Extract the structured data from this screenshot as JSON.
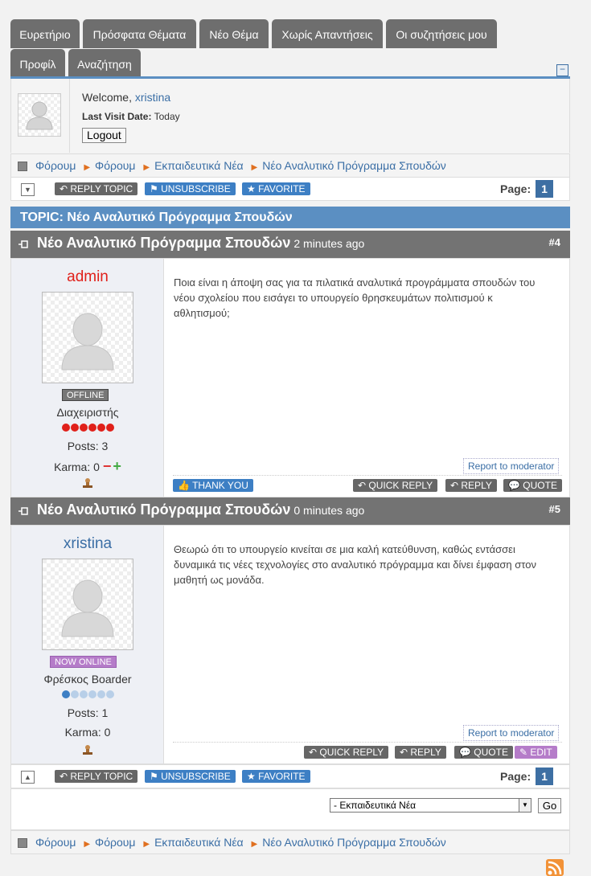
{
  "nav": {
    "tabs": [
      "Ευρετήριο",
      "Πρόσφατα Θέματα",
      "Νέο Θέμα",
      "Χωρίς Απαντήσεις",
      "Οι συζητήσεις μου",
      "Προφίλ",
      "Αναζήτηση"
    ]
  },
  "profile": {
    "welcome_prefix": "Welcome,",
    "username": "xristina",
    "last_visit_label": "Last Visit Date:",
    "last_visit_value": "Today",
    "logout_label": "Logout",
    "collapse_symbol": "−"
  },
  "breadcrumb": [
    "Φόρουμ",
    "Φόρουμ",
    "Εκπαιδευτικά Νέα",
    "Νέο Αναλυτικό Πρόγραμμα Σπουδών"
  ],
  "actions": {
    "reply_topic": "REPLY TOPIC",
    "unsubscribe": "UNSUBSCRIBE",
    "favorite": "FAVORITE",
    "page_label": "Page:",
    "page_number": "1"
  },
  "topic": {
    "title": "TOPIC: Νέο Αναλυτικό Πρόγραμμα Σπουδών"
  },
  "posts": [
    {
      "title": "Νέο Αναλυτικό Πρόγραμμα Σπουδών",
      "ago": "2 minutes ago",
      "number": "#4",
      "author": "admin",
      "author_color": "#e0201a",
      "status": "OFFLINE",
      "status_color": "#777777",
      "rank": "Διαχειριστής",
      "posts_label": "Posts: 3",
      "karma_label": "Karma: 0",
      "karma_minus": "−",
      "karma_plus": "+",
      "message": "Ποια είναι η άποψη σας για τα πιλατικά αναλυτικά προγράμματα σπουδών του νέου σχολείου που εισάγει το υπουργείο θρησκευμάτων πολιτισμού κ αθλητισμού;",
      "report_label": "Report to moderator",
      "thank_you": "THANK YOU",
      "quick_reply": "QUICK REPLY",
      "reply": "REPLY",
      "quote": "QUOTE"
    },
    {
      "title": "Νέο Αναλυτικό Πρόγραμμα Σπουδών",
      "ago": "0 minutes ago",
      "number": "#5",
      "author": "xristina",
      "author_color": "#3a6ea5",
      "status": "NOW ONLINE",
      "status_color": "#b57cc9",
      "rank": "Φρέσκος Boarder",
      "posts_label": "Posts: 1",
      "karma_label": "Karma: 0",
      "message": "Θεωρώ ότι το υπουργείο κινείται σε μια καλή κατεύθυνση, καθώς εντάσσει δυναμικά τις νέες τεχνολογίες στο αναλυτικό πρόγραμμα και δίνει έμφαση στον μαθητή ως μονάδα.",
      "report_label": "Report to moderator",
      "quick_reply": "QUICK REPLY",
      "reply": "REPLY",
      "quote": "QUOTE",
      "edit": "EDIT"
    }
  ],
  "jump": {
    "selected": "- Εκπαιδευτικά Νέα",
    "go_label": "Go"
  },
  "colors": {
    "accent": "#5b8fc2",
    "tab_bg": "#6e6e6e",
    "button_dark": "#666666",
    "button_blue": "#3d7fc4"
  }
}
